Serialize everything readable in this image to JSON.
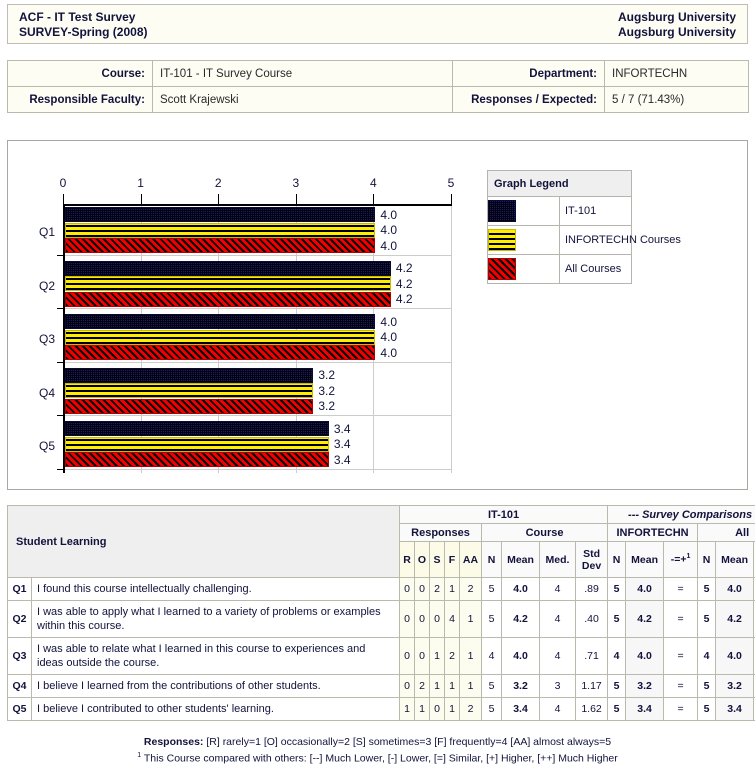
{
  "header": {
    "left_line1": "ACF - IT Test Survey",
    "left_line2": "SURVEY-Spring (2008)",
    "right_line1": "Augsburg University",
    "right_line2": "Augsburg University"
  },
  "info": {
    "course_label": "Course:",
    "course_value": "IT-101 - IT Survey Course",
    "department_label": "Department:",
    "department_value": "INFORTECHN",
    "faculty_label": "Responsible Faculty:",
    "faculty_value": "Scott Krajewski",
    "responses_label": "Responses / Expected:",
    "responses_value": "5 / 7 (71.43%)"
  },
  "legend": {
    "title": "Graph Legend",
    "items": [
      {
        "label": "IT-101",
        "color": "#191970"
      },
      {
        "label": "INFORTECHN Courses",
        "color": "#ffee00"
      },
      {
        "label": "All Courses",
        "color": "#f20000"
      }
    ]
  },
  "chart_data": {
    "type": "bar",
    "orientation": "horizontal",
    "title": "",
    "xlabel": "",
    "ylabel": "",
    "xlim": [
      0,
      5
    ],
    "xticks": [
      "0",
      "1",
      "2",
      "3",
      "4",
      "5"
    ],
    "grid": true,
    "legend_position": "right",
    "categories": [
      "Q1",
      "Q2",
      "Q3",
      "Q4",
      "Q5"
    ],
    "series": [
      {
        "name": "IT-101",
        "color": "#191970",
        "values": [
          4.0,
          4.2,
          4.0,
          3.2,
          3.4
        ],
        "labels": [
          "4.0",
          "4.2",
          "4.0",
          "3.2",
          "3.4"
        ]
      },
      {
        "name": "INFORTECHN Courses",
        "color": "#ffee00",
        "values": [
          4.0,
          4.2,
          4.0,
          3.2,
          3.4
        ],
        "labels": [
          "4.0",
          "4.2",
          "4.0",
          "3.2",
          "3.4"
        ]
      },
      {
        "name": "All Courses",
        "color": "#f20000",
        "values": [
          4.0,
          4.2,
          4.0,
          3.2,
          3.4
        ],
        "labels": [
          "4.0",
          "4.2",
          "4.0",
          "3.2",
          "3.4"
        ]
      }
    ]
  },
  "table": {
    "section_title": "Student Learning",
    "top_group_course": "IT-101",
    "top_group_comparisons": "--- Survey Comparisons ---",
    "sub_responses": "Responses",
    "sub_course": "Course",
    "sub_infortechn": "INFORTECHN",
    "sub_all": "All",
    "cols": {
      "r": "R",
      "o": "O",
      "s": "S",
      "f": "F",
      "aa": "AA",
      "n": "N",
      "mean": "Mean",
      "med": "Med.",
      "std1": "Std",
      "std2": "Dev",
      "cmp": "-=+"
    },
    "rows": [
      {
        "q": "Q1",
        "text": "I found this course intellectually challenging.",
        "r": "0",
        "o": "0",
        "s": "2",
        "f": "1",
        "aa": "2",
        "n": "5",
        "mean": "4.0",
        "med": "4",
        "std": ".89",
        "d_n": "5",
        "d_mean": "4.0",
        "d_cmp": "=",
        "a_n": "5",
        "a_mean": "4.0",
        "a_cmp": "="
      },
      {
        "q": "Q2",
        "text": "I was able to apply what I learned to a variety of problems or examples within this course.",
        "r": "0",
        "o": "0",
        "s": "0",
        "f": "4",
        "aa": "1",
        "n": "5",
        "mean": "4.2",
        "med": "4",
        "std": ".40",
        "d_n": "5",
        "d_mean": "4.2",
        "d_cmp": "=",
        "a_n": "5",
        "a_mean": "4.2",
        "a_cmp": "="
      },
      {
        "q": "Q3",
        "text": "I was able to relate what I learned in this course to experiences and ideas outside the course.",
        "r": "0",
        "o": "0",
        "s": "1",
        "f": "2",
        "aa": "1",
        "n": "4",
        "mean": "4.0",
        "med": "4",
        "std": ".71",
        "d_n": "4",
        "d_mean": "4.0",
        "d_cmp": "=",
        "a_n": "4",
        "a_mean": "4.0",
        "a_cmp": "="
      },
      {
        "q": "Q4",
        "text": "I believe I learned from the contributions of other students.",
        "r": "0",
        "o": "2",
        "s": "1",
        "f": "1",
        "aa": "1",
        "n": "5",
        "mean": "3.2",
        "med": "3",
        "std": "1.17",
        "d_n": "5",
        "d_mean": "3.2",
        "d_cmp": "=",
        "a_n": "5",
        "a_mean": "3.2",
        "a_cmp": "="
      },
      {
        "q": "Q5",
        "text": "I believe I contributed to other students' learning.",
        "r": "1",
        "o": "1",
        "s": "0",
        "f": "1",
        "aa": "2",
        "n": "5",
        "mean": "3.4",
        "med": "4",
        "std": "1.62",
        "d_n": "5",
        "d_mean": "3.4",
        "d_cmp": "=",
        "a_n": "5",
        "a_mean": "3.4",
        "a_cmp": "="
      }
    ]
  },
  "footer": {
    "line1_label": "Responses:",
    "line1_text": " [R] rarely=1  [O] occasionally=2  [S] sometimes=3  [F] frequently=4  [AA] almost always=5",
    "line2_sup": "1",
    "line2_text": " This Course compared with others: [--] Much Lower,  [-] Lower,  [=] Similar,  [+] Higher,  [++] Much Higher"
  }
}
